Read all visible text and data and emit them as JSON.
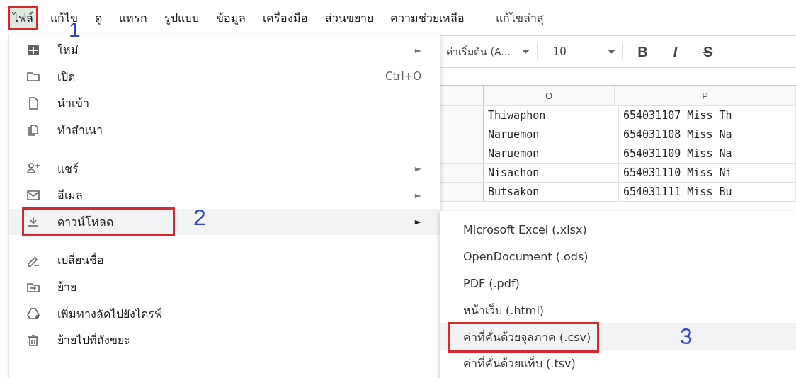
{
  "menubar": {
    "items": [
      {
        "label": "ไฟล์",
        "selected": true,
        "callout": "1"
      },
      {
        "label": "แก้ไข",
        "selected": false
      },
      {
        "label": "ดู",
        "selected": false
      },
      {
        "label": "แทรก",
        "selected": false
      },
      {
        "label": "รูปแบบ",
        "selected": false
      },
      {
        "label": "ข้อมูล",
        "selected": false
      },
      {
        "label": "เครื่องมือ",
        "selected": false
      },
      {
        "label": "ส่วนขยาย",
        "selected": false
      },
      {
        "label": "ความช่วยเหลือ",
        "selected": false
      }
    ],
    "last_edit": "แก้ไขล่าสุ"
  },
  "toolbar": {
    "font": "ค่าเริ่มต้น (A...",
    "size": "10",
    "bold": "B",
    "italic": "I",
    "strike": "S"
  },
  "sheet": {
    "columns": [
      "O",
      "P"
    ],
    "rows": [
      [
        "Thiwaphon",
        "654031107 Miss Th"
      ],
      [
        "Naruemon",
        "654031108 Miss Na"
      ],
      [
        "Naruemon",
        "654031109 Miss Na"
      ],
      [
        "Nisachon",
        "654031110 Miss Ni"
      ],
      [
        "Butsakon",
        "654031111 Miss Bu"
      ]
    ]
  },
  "file_menu": {
    "items": [
      {
        "kind": "item",
        "label": "ใหม่",
        "arrow": "►",
        "selected": false
      },
      {
        "kind": "item",
        "label": "เปิด",
        "shortcut": "Ctrl+O",
        "selected": false
      },
      {
        "kind": "item",
        "label": "นำเข้า",
        "selected": false
      },
      {
        "kind": "item",
        "label": "ทำสำเนา",
        "selected": false
      },
      {
        "kind": "separator"
      },
      {
        "kind": "item",
        "label": "แชร์",
        "arrow": "►",
        "selected": false
      },
      {
        "kind": "item",
        "label": "อีเมล",
        "arrow": "►",
        "selected": false
      },
      {
        "kind": "item",
        "label": "ดาวน์โหลด",
        "arrow": "►",
        "selected": true,
        "callout": "2"
      },
      {
        "kind": "separator"
      },
      {
        "kind": "item",
        "label": "เปลี่ยนชื่อ",
        "selected": false
      },
      {
        "kind": "item",
        "label": "ย้าย",
        "selected": false
      },
      {
        "kind": "item",
        "label": "เพิ่มทางลัดไปยังไดรฟ์",
        "selected": false
      },
      {
        "kind": "item",
        "label": "ย้ายไปที่ถังขยะ",
        "selected": false
      },
      {
        "kind": "separator"
      }
    ]
  },
  "download_menu": {
    "items": [
      {
        "label": "Microsoft Excel (.xlsx)",
        "selected": false
      },
      {
        "label": "OpenDocument (.ods)",
        "selected": false
      },
      {
        "label": "PDF (.pdf)",
        "selected": false
      },
      {
        "label": "หน้าเว็บ (.html)",
        "selected": false
      },
      {
        "label": "ค่าที่คั่นด้วยจุลภาค (.csv)",
        "selected": true,
        "callout": "3"
      },
      {
        "label": "ค่าที่คั่นด้วยแท็บ (.tsv)",
        "selected": false
      }
    ]
  }
}
